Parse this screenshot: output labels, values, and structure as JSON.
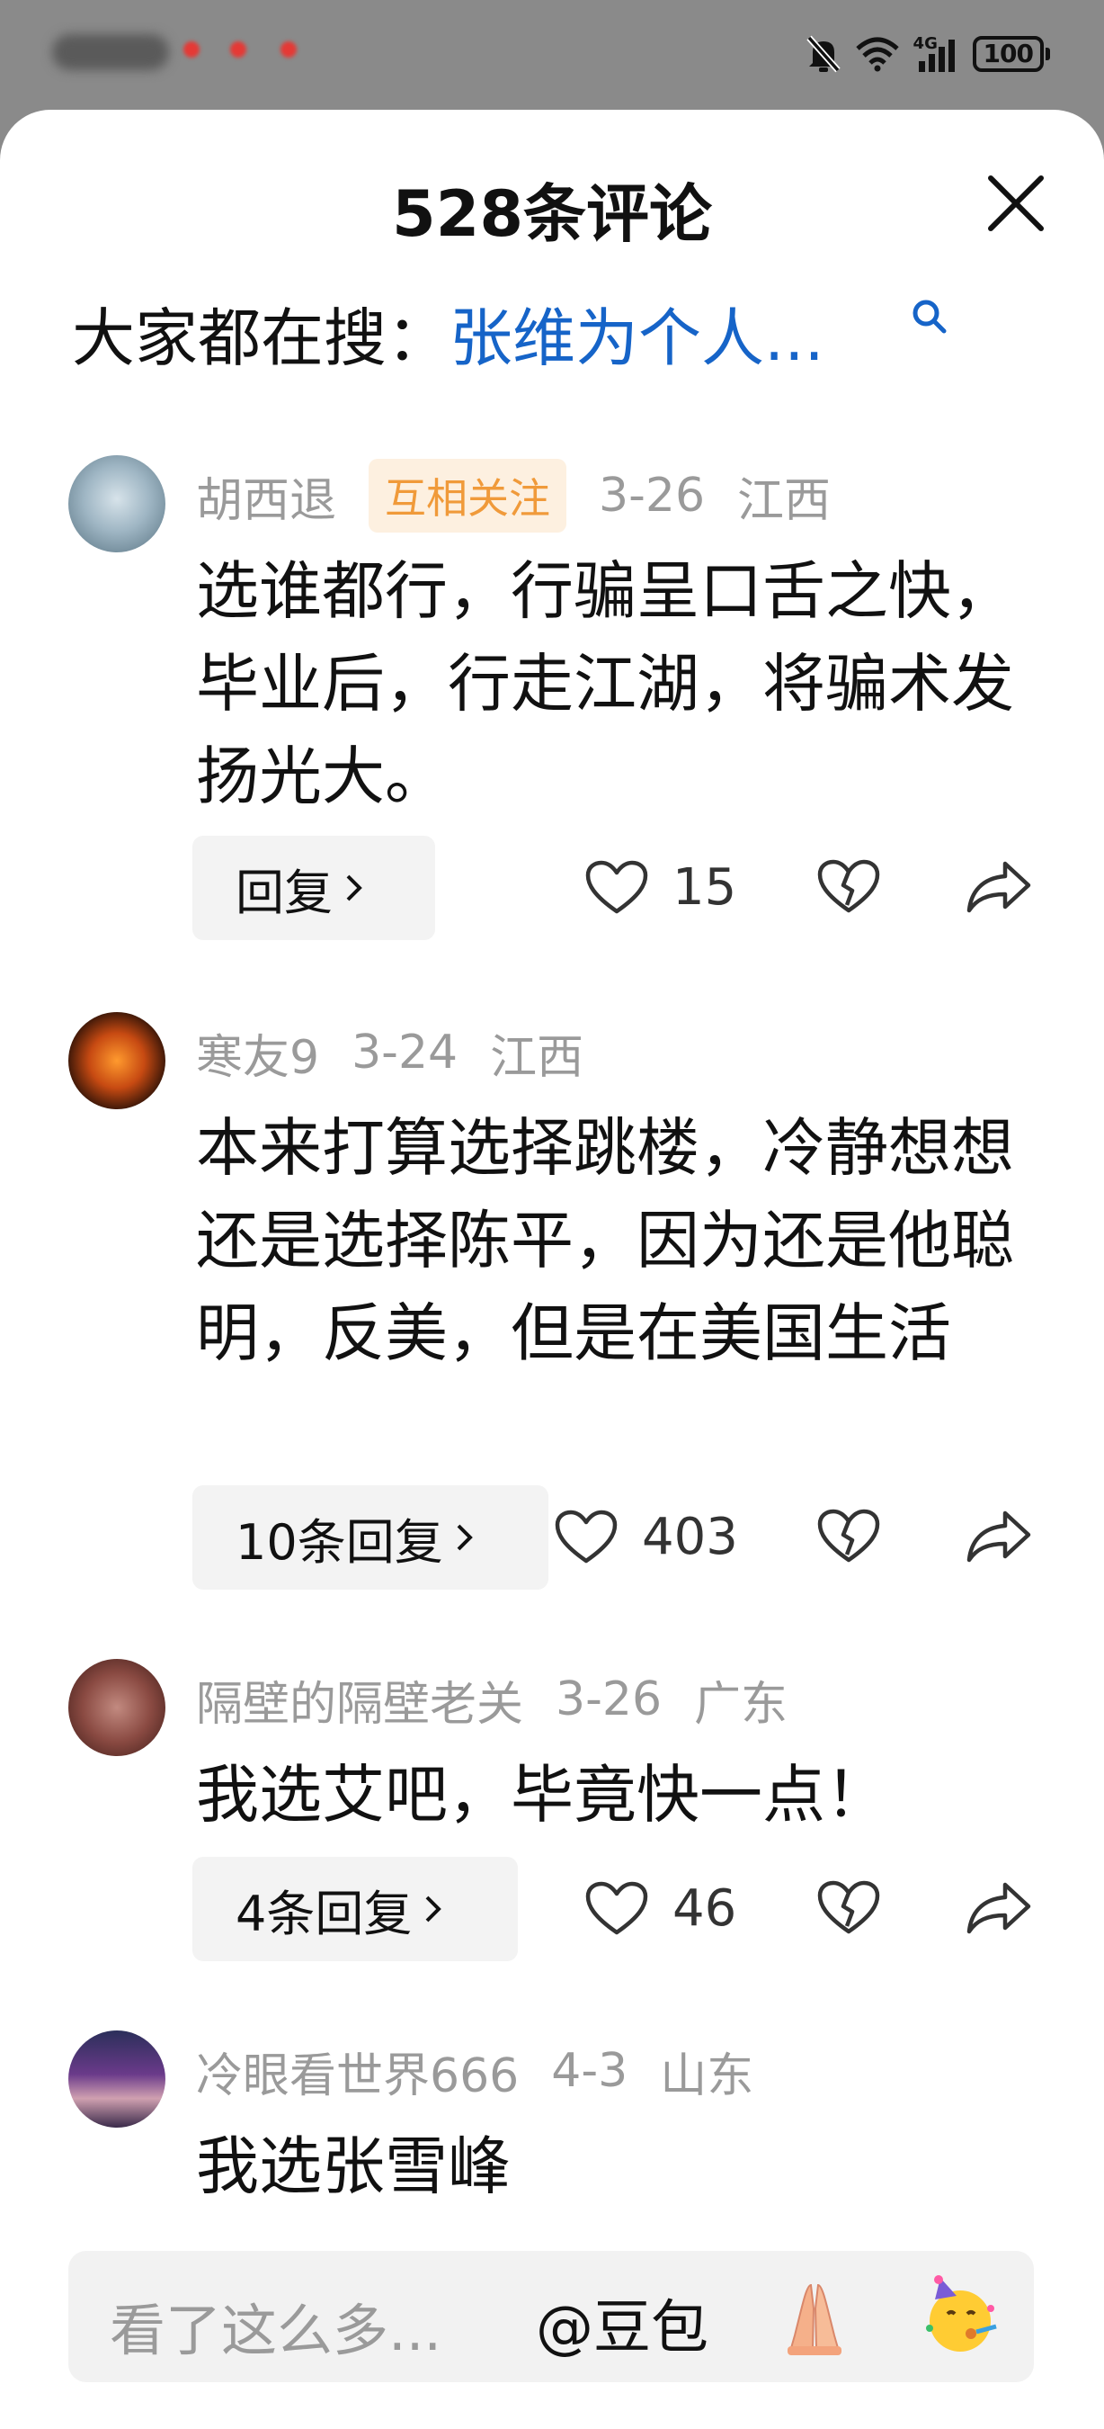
{
  "status_bar": {
    "battery": "100",
    "network": "4G"
  },
  "sheet": {
    "title": "528条评论",
    "search_prefix": "大家都在搜：",
    "search_keyword": "张维为个人..."
  },
  "comments": [
    {
      "username": "胡西退",
      "badge": "互相关注",
      "date": "3-26",
      "location": "江西",
      "text": "选谁都行，行骗呈口舌之快，毕业后，行走江湖，将骗术发扬光大。",
      "reply_label": "回复",
      "likes": "15"
    },
    {
      "username": "寒友9",
      "date": "3-24",
      "location": "江西",
      "text": "本来打算选择跳楼，冷静想想还是选择陈平，因为还是他聪明，反美，但是在美国生活",
      "reply_label": "10条回复",
      "likes": "403"
    },
    {
      "username": "隔壁的隔壁老关",
      "date": "3-26",
      "location": "广东",
      "text": "我选艾吧，毕竟快一点！",
      "reply_label": "4条回复",
      "likes": "46"
    },
    {
      "username": "冷眼看世界666",
      "date": "4-3",
      "location": "山东",
      "text": "我选张雪峰"
    }
  ],
  "input_bar": {
    "placeholder": "看了这么多...",
    "mention_label": "@豆包",
    "emoji_1": "pray-hands-icon",
    "emoji_2": "party-face-icon"
  },
  "colors": {
    "keyword_blue": "#1664c8",
    "badge_bg": "#fdf0e0",
    "badge_text": "#f09a3a",
    "meta_gray": "#9a9a9a"
  }
}
